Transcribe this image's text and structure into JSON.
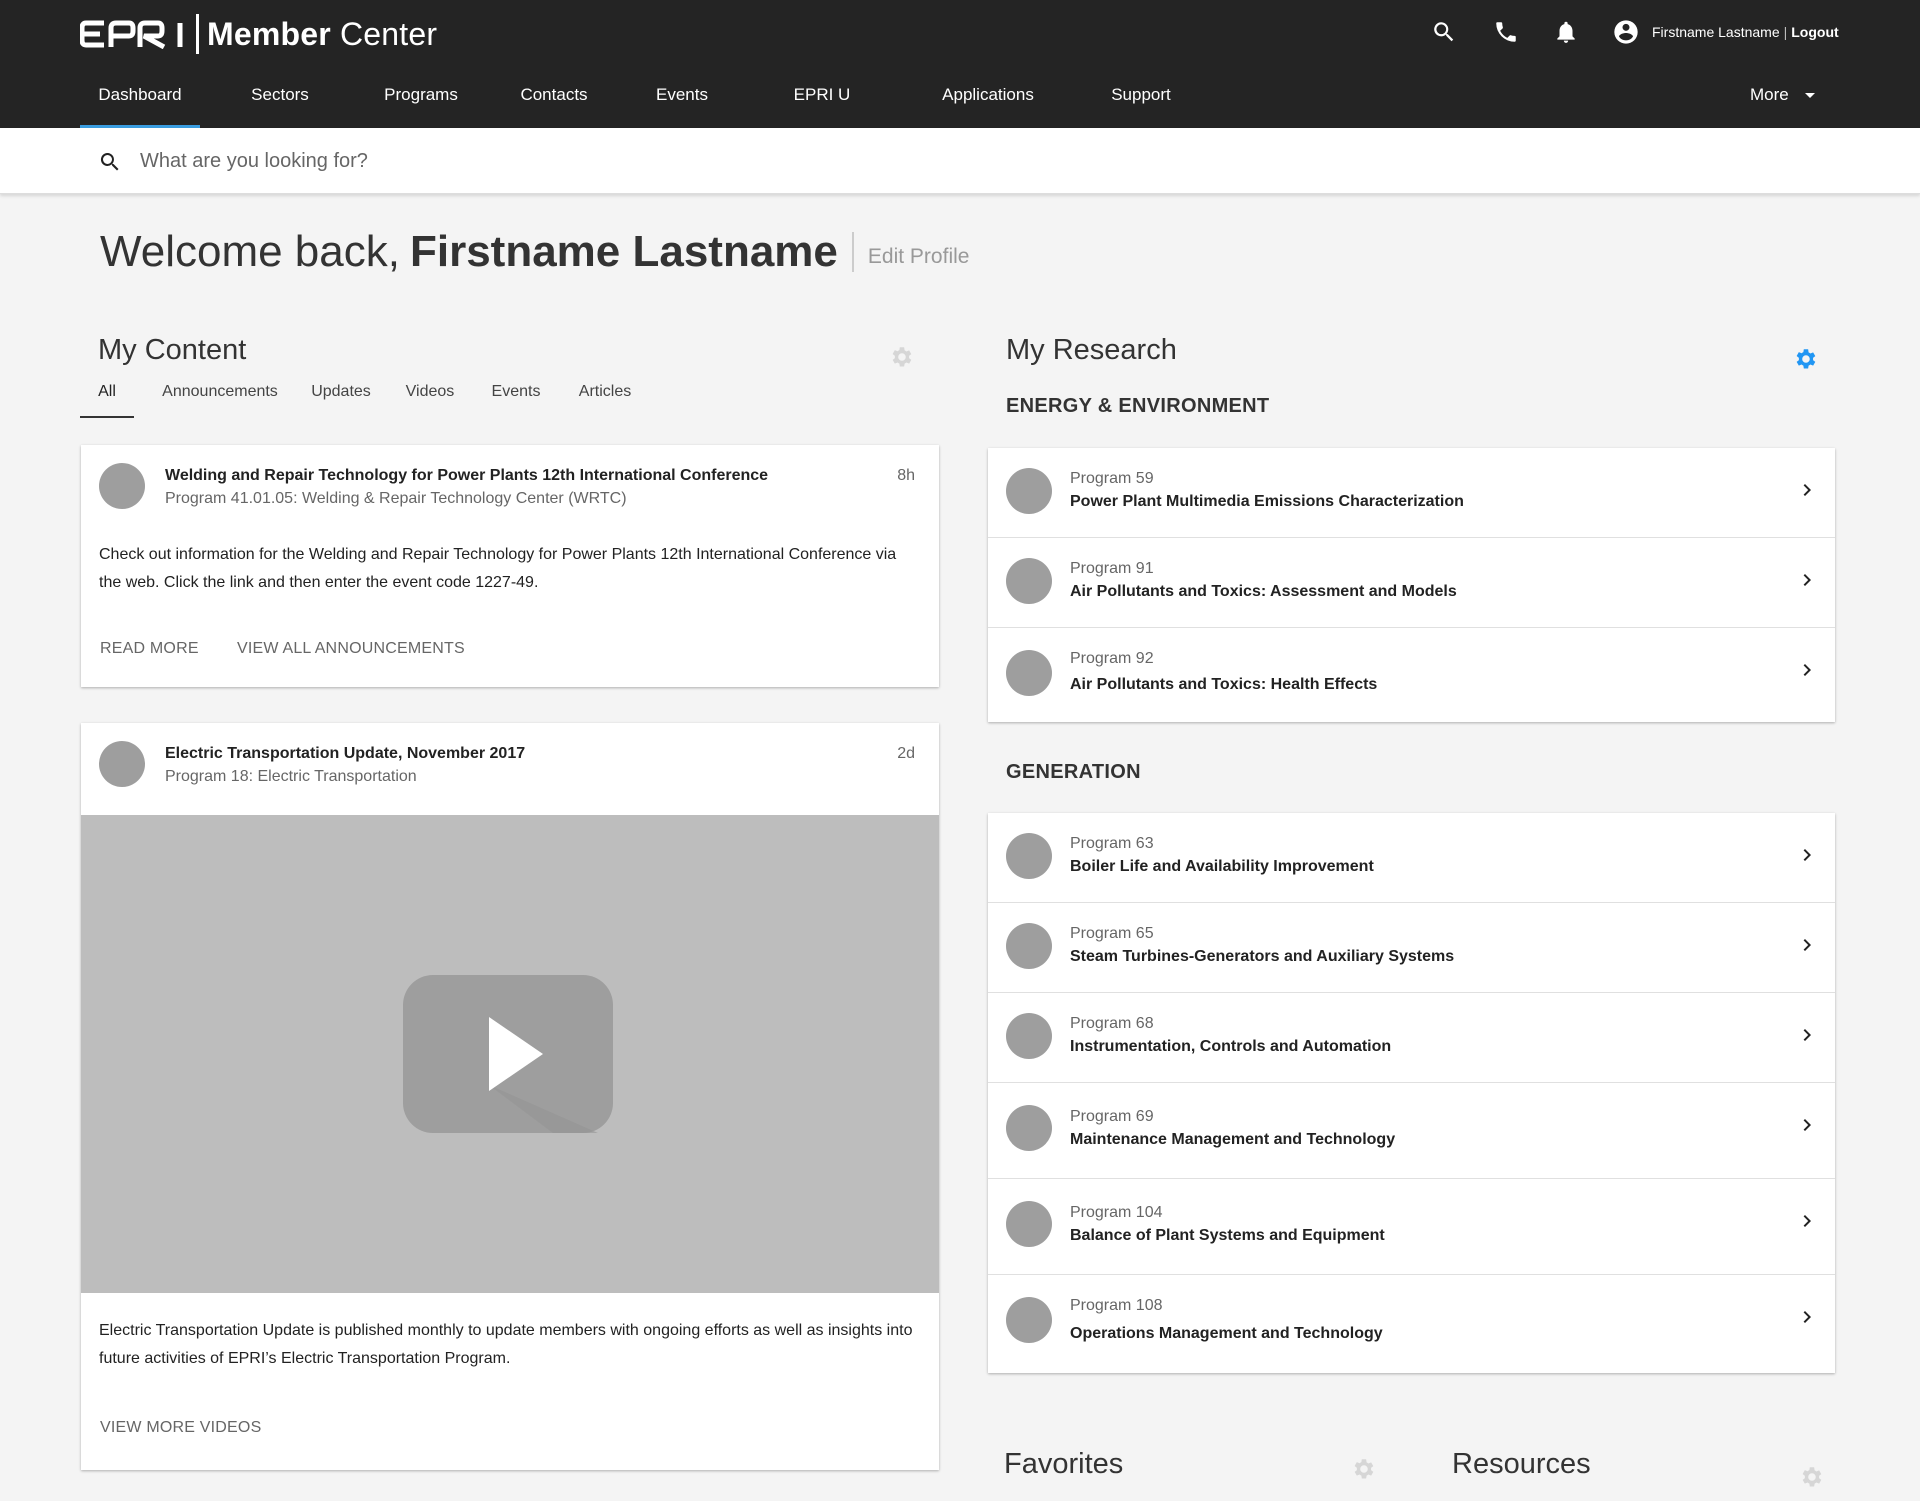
{
  "header": {
    "logo_mark": "EPRI",
    "logo_bold": "Member",
    "logo_light": " Center",
    "user_name": "Firstname Lastname",
    "separator": "|",
    "logout_label": "Logout"
  },
  "nav": {
    "items": [
      {
        "label": "Dashboard"
      },
      {
        "label": "Sectors"
      },
      {
        "label": "Programs"
      },
      {
        "label": "Contacts"
      },
      {
        "label": "Events"
      },
      {
        "label": "EPRI U"
      },
      {
        "label": "Applications"
      },
      {
        "label": "Support"
      }
    ],
    "active_index": 0,
    "more_label": "More"
  },
  "search": {
    "placeholder": "What are you looking for?"
  },
  "welcome": {
    "greeting": "Welcome back,",
    "name": "Firstname Lastname",
    "edit_profile": "Edit Profile"
  },
  "my_content": {
    "title": "My Content",
    "tabs": [
      {
        "label": "All"
      },
      {
        "label": "Announcements"
      },
      {
        "label": "Updates"
      },
      {
        "label": "Videos"
      },
      {
        "label": "Events"
      },
      {
        "label": "Articles"
      }
    ],
    "active_tab": 0,
    "posts": [
      {
        "title": "Welding and Repair Technology for Power Plants 12th International Conference",
        "subtitle": "Program 41.01.05: Welding & Repair Technology Center (WRTC)",
        "time": "8h",
        "body": "Check out information for the Welding and Repair Technology for Power Plants 12th International Conference via the web. Click the link and then enter the event code 1227-49.",
        "actions": [
          "READ MORE",
          "VIEW ALL ANNOUNCEMENTS"
        ]
      },
      {
        "title": "Electric Transportation Update, November 2017",
        "subtitle": "Program 18: Electric Transportation",
        "time": "2d",
        "body": "Electric Transportation Update is published monthly to update members with ongoing efforts as well as insights into future activities of EPRI’s Electric Transportation Program.",
        "actions": [
          "VIEW MORE VIDEOS"
        ]
      }
    ]
  },
  "my_research": {
    "title": "My Research",
    "accent_color": "#2196f3",
    "categories": [
      {
        "name": "ENERGY & ENVIRONMENT",
        "programs": [
          {
            "number": "Program 59",
            "name": "Power Plant Multimedia Emissions Characterization"
          },
          {
            "number": "Program 91",
            "name": "Air Pollutants and Toxics: Assessment and Models"
          },
          {
            "number": "Program 92",
            "name": "Air Pollutants and Toxics: Health Effects"
          }
        ]
      },
      {
        "name": "GENERATION",
        "programs": [
          {
            "number": "Program 63",
            "name": "Boiler Life and Availability Improvement"
          },
          {
            "number": "Program 65",
            "name": "Steam Turbines-Generators and Auxiliary Systems"
          },
          {
            "number": "Program 68",
            "name": "Instrumentation, Controls and Automation"
          },
          {
            "number": "Program 69",
            "name": "Maintenance Management and Technology"
          },
          {
            "number": "Program 104",
            "name": "Balance of Plant Systems and Equipment"
          },
          {
            "number": "Program 108",
            "name": "Operations Management and Technology"
          }
        ]
      }
    ]
  },
  "favorites": {
    "title": "Favorites"
  },
  "resources": {
    "title": "Resources"
  }
}
